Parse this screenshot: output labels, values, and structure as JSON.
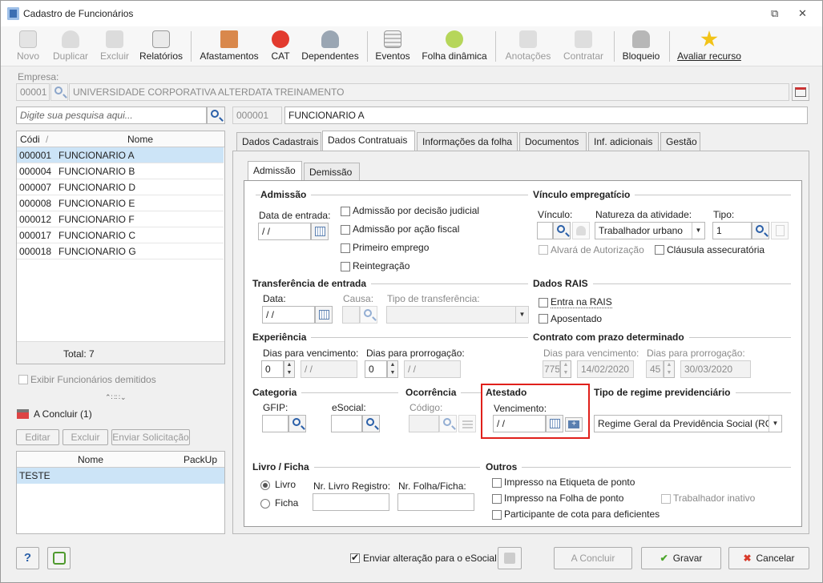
{
  "window": {
    "title": "Cadastro de Funcionários",
    "restore": "⧉",
    "close": "✕"
  },
  "toolbar": [
    {
      "label": "Novo",
      "enabled": false,
      "icon": "new-document-icon"
    },
    {
      "label": "Duplicar",
      "enabled": false,
      "icon": "duplicate-users-icon"
    },
    {
      "label": "Excluir",
      "enabled": false,
      "icon": "trash-icon"
    },
    {
      "label": "Relatórios",
      "enabled": true,
      "icon": "report-icon"
    },
    {
      "label": "Afastamentos",
      "enabled": true,
      "icon": "house-arrow-icon"
    },
    {
      "label": "CAT",
      "enabled": true,
      "icon": "red-cross-icon"
    },
    {
      "label": "Dependentes",
      "enabled": true,
      "icon": "users-icon"
    },
    {
      "label": "Eventos",
      "enabled": true,
      "icon": "list-icon"
    },
    {
      "label": "Folha dinâmica",
      "enabled": true,
      "icon": "dynamic-sheet-icon"
    },
    {
      "label": "Anotações",
      "enabled": false,
      "icon": "annotation-icon"
    },
    {
      "label": "Contratar",
      "enabled": false,
      "icon": "hire-icon"
    },
    {
      "label": "Bloqueio",
      "enabled": true,
      "icon": "lock-icon"
    },
    {
      "label": "Avaliar recurso",
      "enabled": true,
      "icon": "star-icon"
    }
  ],
  "empresa": {
    "label": "Empresa:",
    "code": "00001",
    "name": "UNIVERSIDADE CORPORATIVA ALTERDATA TREINAMENTO"
  },
  "search": {
    "placeholder": "Digite sua pesquisa aqui..."
  },
  "employee": {
    "code": "000001",
    "name": "FUNCIONARIO A"
  },
  "list": {
    "col_code": "Códi",
    "col_name": "Nome",
    "rows": [
      {
        "code": "000001",
        "name": "FUNCIONARIO A"
      },
      {
        "code": "000004",
        "name": "FUNCIONARIO B"
      },
      {
        "code": "000007",
        "name": "FUNCIONARIO D"
      },
      {
        "code": "000008",
        "name": "FUNCIONARIO E"
      },
      {
        "code": "000012",
        "name": "FUNCIONARIO F"
      },
      {
        "code": "000017",
        "name": "FUNCIONARIO C"
      },
      {
        "code": "000018",
        "name": "FUNCIONARIO G"
      }
    ],
    "total": "Total: 7"
  },
  "exibir_demitidos": "Exibir Funcionários demitidos",
  "concluir": {
    "title": "A Concluir (1)",
    "editar": "Editar",
    "excluir": "Excluir",
    "enviar": "Enviar Solicitação",
    "col_nome": "Nome",
    "col_packup": "PackUp",
    "rows": [
      {
        "nome": "TESTE",
        "packup": ""
      }
    ]
  },
  "tabs": [
    "Dados Cadastrais",
    "Dados Contratuais",
    "Informações da folha",
    "Documentos",
    "Inf. adicionais",
    "Gestão"
  ],
  "subtabs": [
    "Admissão",
    "Demissão"
  ],
  "admissao": {
    "section": "Admissão",
    "data_label": "Data de entrada:",
    "data": " /  /",
    "chk1": "Admissão por decisão judicial",
    "chk2": "Admissão por ação fiscal",
    "chk3": "Primeiro emprego",
    "chk4": "Reintegração"
  },
  "vinculo": {
    "section": "Vínculo empregatício",
    "vinculo_label": "Vínculo:",
    "natureza_label": "Natureza da atividade:",
    "natureza": "Trabalhador urbano",
    "tipo_label": "Tipo:",
    "tipo": "1",
    "alvara": "Alvará de Autorização",
    "clausula": "Cláusula assecuratória"
  },
  "transferencia": {
    "section": "Transferência de entrada",
    "data_label": "Data:",
    "data": " /  /",
    "causa_label": "Causa:",
    "tipo_label": "Tipo de transferência:"
  },
  "rais": {
    "section": "Dados RAIS",
    "entra": "Entra na RAIS",
    "aposentado": "Aposentado"
  },
  "experiencia": {
    "section": "Experiência",
    "dias_venc": "Dias para vencimento:",
    "venc_val": "0",
    "venc_date": " /  /",
    "dias_prorr": "Dias para prorrogação:",
    "prorr_val": "0",
    "prorr_date": " /  /"
  },
  "contrato": {
    "section": "Contrato com prazo determinado",
    "dias_venc": "Dias para vencimento:",
    "venc_val": "775",
    "venc_date": "14/02/2020",
    "dias_prorr": "Dias para prorrogação:",
    "prorr_val": "45",
    "prorr_date": "30/03/2020"
  },
  "categoria": {
    "section": "Categoria",
    "gfip": "GFIP:",
    "esocial": "eSocial:"
  },
  "ocorrencia": {
    "section": "Ocorrência",
    "codigo": "Código:"
  },
  "atestado": {
    "section": "Atestado",
    "venc_label": "Vencimento:",
    "venc": " /  /"
  },
  "regime": {
    "section": "Tipo de regime previdenciário",
    "value": "Regime Geral da Previdência Social (RGPS)"
  },
  "livro": {
    "section": "Livro / Ficha",
    "livro": "Livro",
    "ficha": "Ficha",
    "nr_livro": "Nr. Livro Registro:",
    "nr_folha": "Nr. Folha/Ficha:"
  },
  "outros": {
    "section": "Outros",
    "imp_etiqueta": "Impresso na Etiqueta de ponto",
    "imp_folha": "Impresso na Folha de ponto",
    "inativo": "Trabalhador inativo",
    "cota": "Participante de cota para deficientes"
  },
  "footer": {
    "help": "?",
    "enviar": "Enviar alteração para o eSocial",
    "concluir": "A Concluir",
    "gravar": "Gravar",
    "cancelar": "Cancelar"
  },
  "colors": {
    "highlight": "#e0201b",
    "selection": "#cce4f7"
  }
}
